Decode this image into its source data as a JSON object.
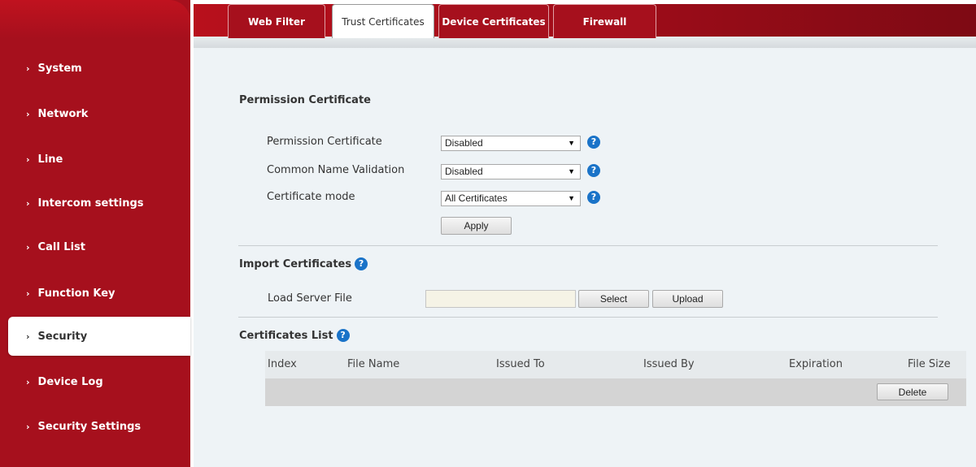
{
  "sidebar": {
    "items": [
      {
        "label": "System"
      },
      {
        "label": "Network"
      },
      {
        "label": "Line"
      },
      {
        "label": "Intercom settings"
      },
      {
        "label": "Call List"
      },
      {
        "label": "Function Key"
      },
      {
        "label": "Security",
        "active": true
      },
      {
        "label": "Device Log"
      },
      {
        "label": "Security Settings"
      }
    ]
  },
  "tabs": [
    {
      "label": "Web Filter"
    },
    {
      "label": "Trust Certificates",
      "active": true
    },
    {
      "label": "Device Certificates"
    },
    {
      "label": "Firewall"
    }
  ],
  "permission": {
    "title": "Permission Certificate",
    "fields": [
      {
        "label": "Permission Certificate",
        "value": "Disabled"
      },
      {
        "label": "Common Name Validation",
        "value": "Disabled"
      },
      {
        "label": "Certificate mode",
        "value": "All Certificates"
      }
    ],
    "apply_label": "Apply"
  },
  "import": {
    "title": "Import Certificates",
    "load_label": "Load Server File",
    "file_value": "",
    "select_label": "Select",
    "upload_label": "Upload"
  },
  "certlist": {
    "title": "Certificates List",
    "columns": [
      "Index",
      "File Name",
      "Issued To",
      "Issued By",
      "Expiration",
      "File Size"
    ],
    "delete_label": "Delete"
  },
  "icons": {
    "help": "help-icon",
    "chevron": "chevron-right-icon"
  },
  "colors": {
    "brand": "#a6101d",
    "help": "#1a73c8",
    "content_bg": "#eef3f6"
  }
}
